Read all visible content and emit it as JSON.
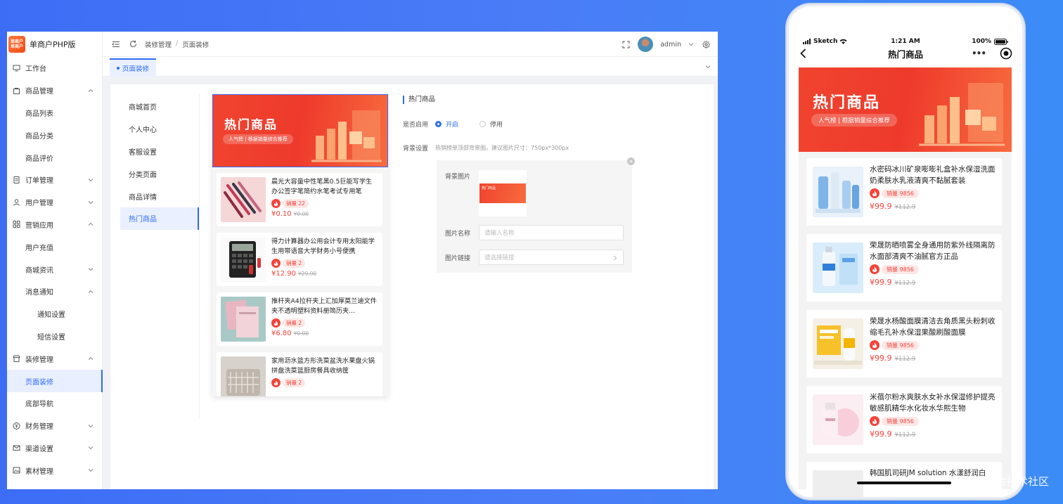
{
  "app": {
    "logo_top": "单商户",
    "logo_bottom": "单商户",
    "title": "单商户PHP版"
  },
  "sidebar": {
    "items": [
      {
        "label": "工作台"
      },
      {
        "label": "商品管理"
      },
      {
        "label": "商品列表"
      },
      {
        "label": "商品分类"
      },
      {
        "label": "商品评价"
      },
      {
        "label": "订单管理"
      },
      {
        "label": "用户管理"
      },
      {
        "label": "营销应用"
      },
      {
        "label": "用户充值"
      },
      {
        "label": "商城资讯"
      },
      {
        "label": "消息通知"
      },
      {
        "label": "通知设置"
      },
      {
        "label": "短信设置"
      },
      {
        "label": "装修管理"
      },
      {
        "label": "页面装修"
      },
      {
        "label": "底部导航"
      },
      {
        "label": "财务管理"
      },
      {
        "label": "渠道设置"
      },
      {
        "label": "素材管理"
      }
    ]
  },
  "topbar": {
    "breadcrumb": [
      "装修管理",
      "页面装修"
    ],
    "separator": "/",
    "user": "admin"
  },
  "tabs": {
    "active": "页面装修"
  },
  "pages": {
    "items": [
      "商城首页",
      "个人中心",
      "客服设置",
      "分类页面",
      "商品详情",
      "热门商品"
    ],
    "active": "热门商品"
  },
  "banner": {
    "title": "热门商品",
    "subtitle": "人气榜 | 根据销量综合推荐"
  },
  "preview_products": [
    {
      "title": "晨光大容量中性笔黑0.5巨能写学生办公签字笔简约水笔考试专用笔",
      "sales": "销量 22",
      "price": "¥0.10",
      "old_price": "¥0.00"
    },
    {
      "title": "得力计算器办公用会计专用太阳能学生用带语音大学财务小号便携",
      "sales": "销量 2",
      "price": "¥12.90",
      "old_price": "¥29.90"
    },
    {
      "title": "推杆夹A4拉杆夹上汇加厚莫兰迪文件夹不透明塑料资料册简历夹...",
      "sales": "销量 2",
      "price": "¥6.80",
      "old_price": "¥0.00"
    },
    {
      "title": "家用沥水篮方形洗菜盆洗水果盘火锅拼盘洗菜篮厨房餐具收纳筐",
      "sales": "销量 2",
      "price": "",
      "old_price": ""
    }
  ],
  "form": {
    "section_title": "热门商品",
    "enable_label": "是否启用",
    "enable_on": "开启",
    "enable_off": "停用",
    "bg_label": "背景设置",
    "bg_hint": "热销榜单顶部背景图。建议图片尺寸：750px*300px",
    "image_label": "背景图片",
    "thumb_text": "热门商品",
    "close_icon": "×",
    "name_label": "图片名称",
    "name_placeholder": "请输入名称",
    "link_label": "图片链接",
    "link_placeholder": "请选择链接"
  },
  "phone": {
    "carrier": "Sketch",
    "time": "1:21 AM",
    "battery": "100%",
    "nav_title": "热门商品",
    "more": "•••",
    "products": [
      {
        "title": "水密码冰川矿泉嘭嘭礼盒补水保湿洗面奶柔肤水乳液清爽不黏腻套装",
        "sales": "销量 9856",
        "price": "¥99.9",
        "old_price": "¥112.9"
      },
      {
        "title": "荣晟防晒喷雾全身通用防紫外线隔离防水面部清爽不油腻官方正品",
        "sales": "销量 9856",
        "price": "¥99.9",
        "old_price": "¥112.9"
      },
      {
        "title": "荣晟水杨酸面膜清洁去角质黑头粉刺收缩毛孔补水保湿果酸刷酸面膜",
        "sales": "销量 9856",
        "price": "¥99.9",
        "old_price": "¥112.9"
      },
      {
        "title": "米蓓尔粉水爽肤水女补水保湿修护提亮敏感肌精华水化妆水华熙生物",
        "sales": "销量 9856",
        "price": "¥99.9",
        "old_price": "¥112.9"
      },
      {
        "title": "韩国肌司研JM solution 水漾舒润白",
        "sales": "",
        "price": "",
        "old_price": ""
      }
    ]
  },
  "watermark": "@稀土掘金技术社区",
  "colors": {
    "primary": "#2d6cf5",
    "banner_red": "#f0442f",
    "price_red": "#f5433a",
    "background_blue": "#4a7cf7"
  }
}
